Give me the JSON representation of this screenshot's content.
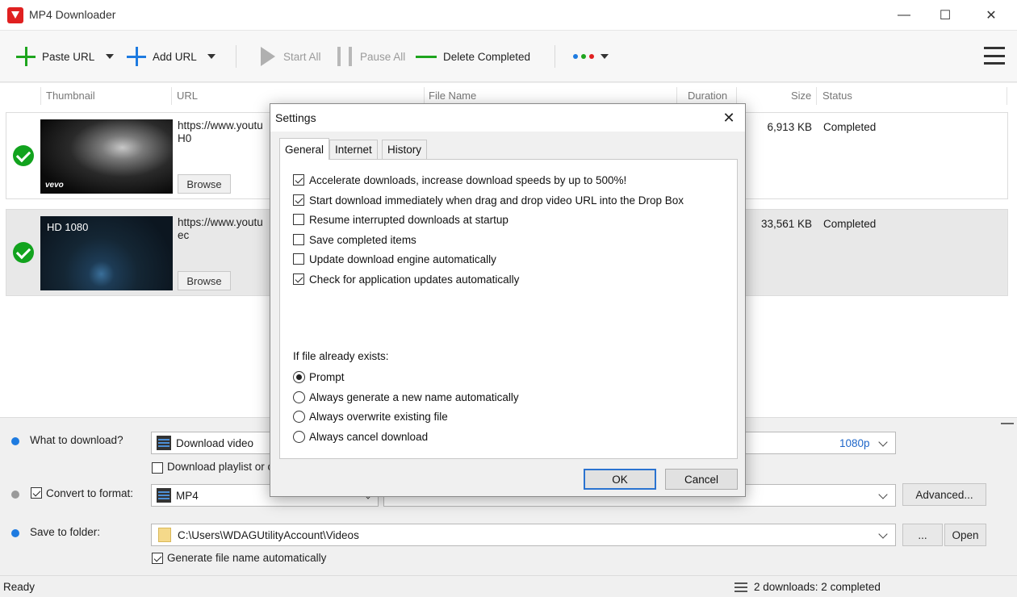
{
  "window": {
    "title": "MP4 Downloader",
    "minimize": "—",
    "maximize": "☐",
    "close": "✕"
  },
  "toolbar": {
    "paste_url": "Paste URL",
    "add_url": "Add URL",
    "start_all": "Start All",
    "pause_all": "Pause All",
    "delete_completed": "Delete Completed",
    "color_dots": [
      "#1e7be0",
      "#1ea51e",
      "#e02020"
    ]
  },
  "columns": {
    "thumbnail": "Thumbnail",
    "url": "URL",
    "file_name": "File Name",
    "duration": "Duration",
    "size": "Size",
    "status": "Status"
  },
  "downloads": [
    {
      "url_line1": "https://www.youtu",
      "url_line2": "H0",
      "browse": "Browse",
      "thumb_label": "vevo",
      "size": "6,913 KB",
      "status": "Completed"
    },
    {
      "url_line1": "https://www.youtu",
      "url_line2": "ec",
      "browse": "Browse",
      "thumb_label": "HD 1080",
      "size": "33,561 KB",
      "status": "Completed"
    }
  ],
  "options": {
    "what_to_download_label": "What to download?",
    "what_to_download_value": "Download video",
    "quality": "1080p",
    "download_playlist": "Download playlist or c",
    "convert_label": "Convert to format:",
    "format": "MP4",
    "advanced": "Advanced...",
    "save_folder_label": "Save to folder:",
    "folder_path": "C:\\Users\\WDAGUtilityAccount\\Videos",
    "browse_folder": "...",
    "open": "Open",
    "generate_name": "Generate file name automatically"
  },
  "statusbar": {
    "left": "Ready",
    "right": "2 downloads: 2 completed"
  },
  "dialog": {
    "title": "Settings",
    "close": "✕",
    "tabs": [
      "General",
      "Internet",
      "History"
    ],
    "checkboxes": [
      {
        "label": "Accelerate downloads, increase download speeds by up to 500%!",
        "checked": true
      },
      {
        "label": "Start download immediately when drag and drop video URL into the Drop Box",
        "checked": true
      },
      {
        "label": "Resume interrupted downloads at startup",
        "checked": false
      },
      {
        "label": "Save completed items",
        "checked": false
      },
      {
        "label": "Update download engine automatically",
        "checked": false
      },
      {
        "label": "Check for application updates automatically",
        "checked": true
      }
    ],
    "file_exists_label": "If file already exists:",
    "radios": [
      {
        "label": "Prompt",
        "checked": true
      },
      {
        "label": "Always generate a new name automatically",
        "checked": false
      },
      {
        "label": "Always overwrite existing file",
        "checked": false
      },
      {
        "label": "Always cancel download",
        "checked": false
      }
    ],
    "ok": "OK",
    "cancel": "Cancel"
  }
}
